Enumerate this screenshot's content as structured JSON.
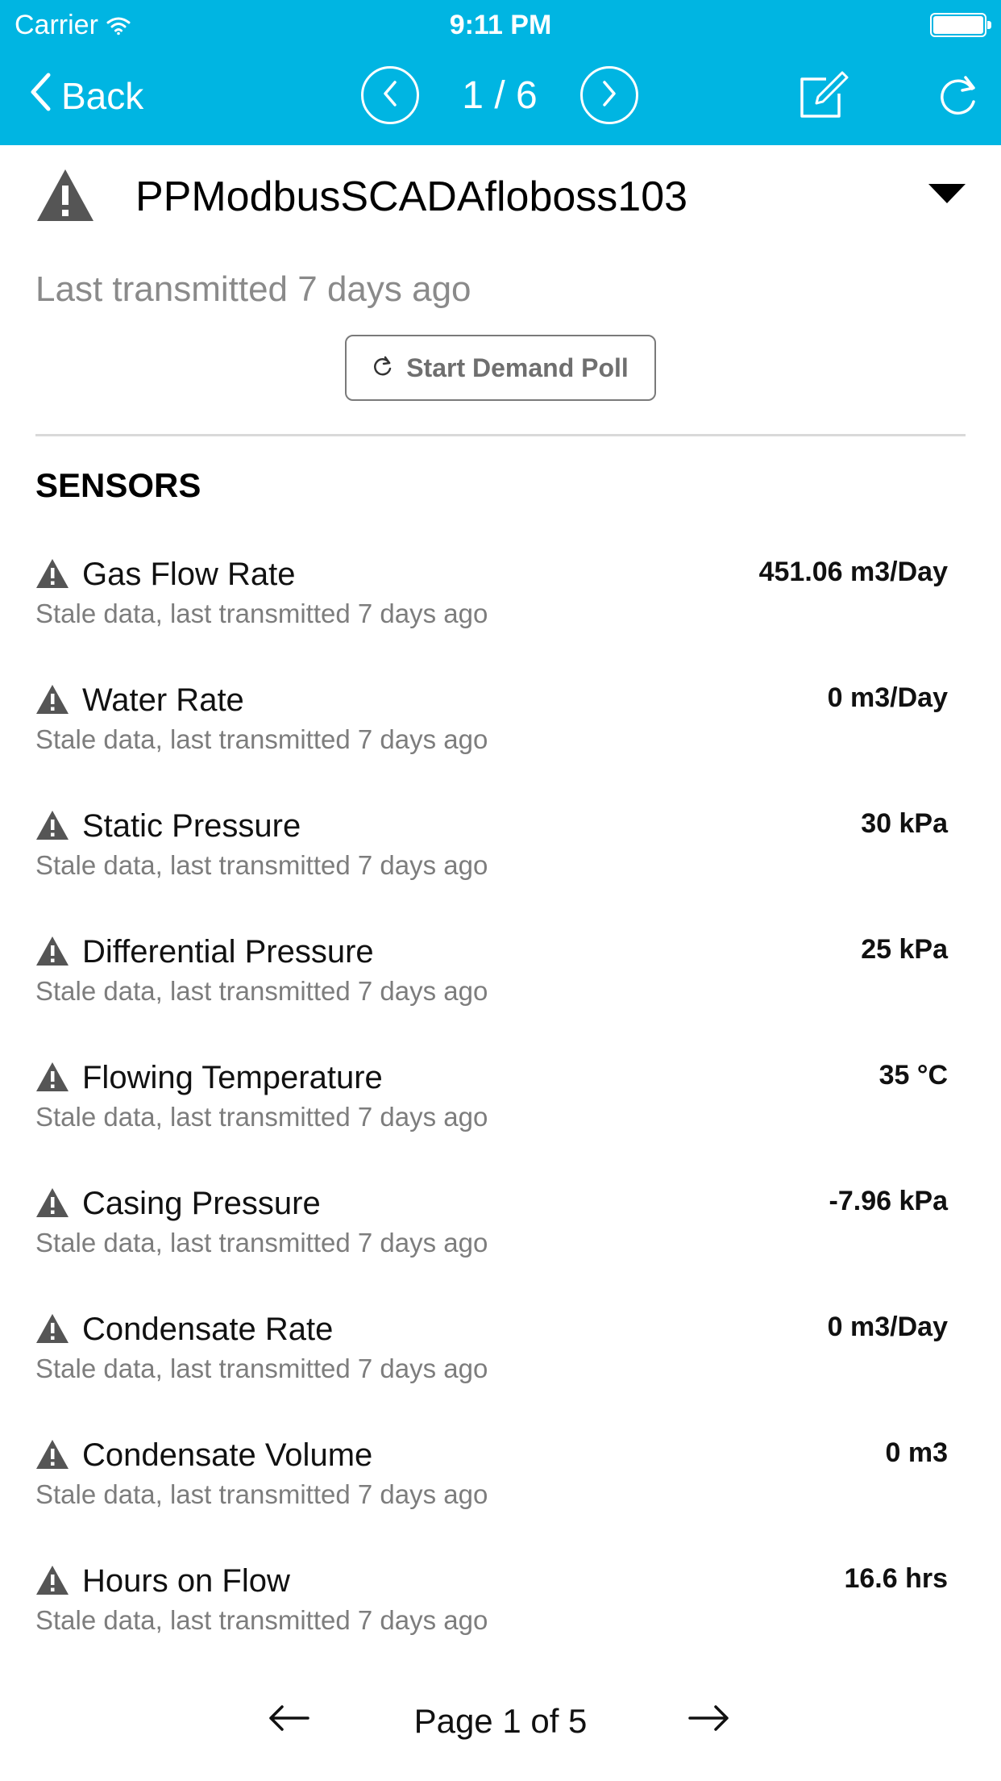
{
  "status_bar": {
    "carrier": "Carrier",
    "time": "9:11 PM"
  },
  "navbar": {
    "back_label": "Back",
    "pager": "1 / 6",
    "accent_color": "#00b5e2"
  },
  "device": {
    "name": "PPModbusSCADAfloboss103",
    "last_transmitted": "Last transmitted 7 days ago",
    "demand_poll_label": "Start Demand Poll"
  },
  "sensors_section": {
    "title": "SENSORS",
    "items": [
      {
        "name": "Gas Flow Rate",
        "status": "Stale data, last transmitted 7 days ago",
        "value": "451.06 m3/Day"
      },
      {
        "name": "Water Rate",
        "status": "Stale data, last transmitted 7 days ago",
        "value": "0 m3/Day"
      },
      {
        "name": "Static Pressure",
        "status": "Stale data, last transmitted 7 days ago",
        "value": "30 kPa"
      },
      {
        "name": "Differential Pressure",
        "status": "Stale data, last transmitted 7 days ago",
        "value": "25 kPa"
      },
      {
        "name": "Flowing Temperature",
        "status": "Stale data, last transmitted 7 days ago",
        "value": "35 °C"
      },
      {
        "name": "Casing Pressure",
        "status": "Stale data, last transmitted 7 days ago",
        "value": "-7.96 kPa"
      },
      {
        "name": "Condensate Rate",
        "status": "Stale data, last transmitted 7 days ago",
        "value": "0 m3/Day"
      },
      {
        "name": "Condensate Volume",
        "status": "Stale data, last transmitted 7 days ago",
        "value": "0 m3"
      },
      {
        "name": "Hours on Flow",
        "status": "Stale data, last transmitted 7 days ago",
        "value": "16.6 hrs"
      }
    ]
  },
  "pagination": {
    "label": "Page 1 of 5"
  }
}
